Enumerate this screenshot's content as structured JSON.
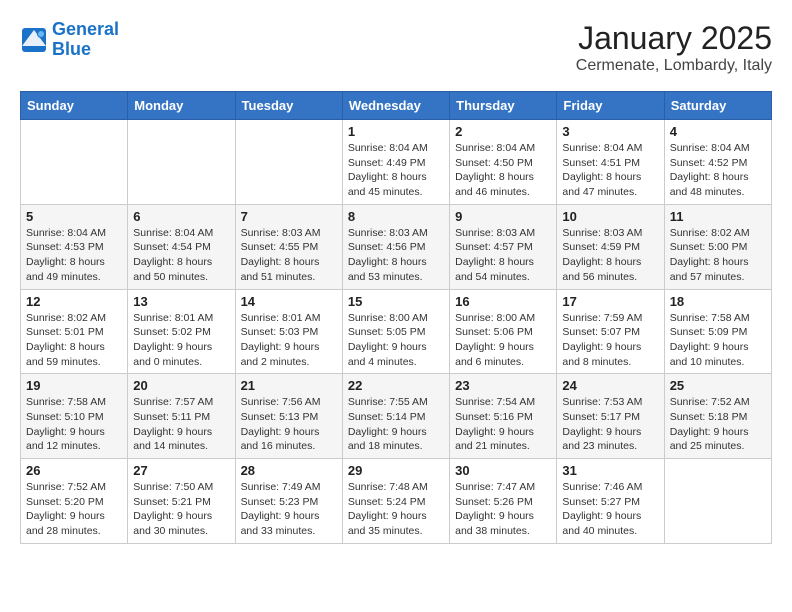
{
  "logo": {
    "line1": "General",
    "line2": "Blue"
  },
  "title": "January 2025",
  "location": "Cermenate, Lombardy, Italy",
  "weekdays": [
    "Sunday",
    "Monday",
    "Tuesday",
    "Wednesday",
    "Thursday",
    "Friday",
    "Saturday"
  ],
  "weeks": [
    [
      {
        "day": "",
        "info": ""
      },
      {
        "day": "",
        "info": ""
      },
      {
        "day": "",
        "info": ""
      },
      {
        "day": "1",
        "info": "Sunrise: 8:04 AM\nSunset: 4:49 PM\nDaylight: 8 hours\nand 45 minutes."
      },
      {
        "day": "2",
        "info": "Sunrise: 8:04 AM\nSunset: 4:50 PM\nDaylight: 8 hours\nand 46 minutes."
      },
      {
        "day": "3",
        "info": "Sunrise: 8:04 AM\nSunset: 4:51 PM\nDaylight: 8 hours\nand 47 minutes."
      },
      {
        "day": "4",
        "info": "Sunrise: 8:04 AM\nSunset: 4:52 PM\nDaylight: 8 hours\nand 48 minutes."
      }
    ],
    [
      {
        "day": "5",
        "info": "Sunrise: 8:04 AM\nSunset: 4:53 PM\nDaylight: 8 hours\nand 49 minutes."
      },
      {
        "day": "6",
        "info": "Sunrise: 8:04 AM\nSunset: 4:54 PM\nDaylight: 8 hours\nand 50 minutes."
      },
      {
        "day": "7",
        "info": "Sunrise: 8:03 AM\nSunset: 4:55 PM\nDaylight: 8 hours\nand 51 minutes."
      },
      {
        "day": "8",
        "info": "Sunrise: 8:03 AM\nSunset: 4:56 PM\nDaylight: 8 hours\nand 53 minutes."
      },
      {
        "day": "9",
        "info": "Sunrise: 8:03 AM\nSunset: 4:57 PM\nDaylight: 8 hours\nand 54 minutes."
      },
      {
        "day": "10",
        "info": "Sunrise: 8:03 AM\nSunset: 4:59 PM\nDaylight: 8 hours\nand 56 minutes."
      },
      {
        "day": "11",
        "info": "Sunrise: 8:02 AM\nSunset: 5:00 PM\nDaylight: 8 hours\nand 57 minutes."
      }
    ],
    [
      {
        "day": "12",
        "info": "Sunrise: 8:02 AM\nSunset: 5:01 PM\nDaylight: 8 hours\nand 59 minutes."
      },
      {
        "day": "13",
        "info": "Sunrise: 8:01 AM\nSunset: 5:02 PM\nDaylight: 9 hours\nand 0 minutes."
      },
      {
        "day": "14",
        "info": "Sunrise: 8:01 AM\nSunset: 5:03 PM\nDaylight: 9 hours\nand 2 minutes."
      },
      {
        "day": "15",
        "info": "Sunrise: 8:00 AM\nSunset: 5:05 PM\nDaylight: 9 hours\nand 4 minutes."
      },
      {
        "day": "16",
        "info": "Sunrise: 8:00 AM\nSunset: 5:06 PM\nDaylight: 9 hours\nand 6 minutes."
      },
      {
        "day": "17",
        "info": "Sunrise: 7:59 AM\nSunset: 5:07 PM\nDaylight: 9 hours\nand 8 minutes."
      },
      {
        "day": "18",
        "info": "Sunrise: 7:58 AM\nSunset: 5:09 PM\nDaylight: 9 hours\nand 10 minutes."
      }
    ],
    [
      {
        "day": "19",
        "info": "Sunrise: 7:58 AM\nSunset: 5:10 PM\nDaylight: 9 hours\nand 12 minutes."
      },
      {
        "day": "20",
        "info": "Sunrise: 7:57 AM\nSunset: 5:11 PM\nDaylight: 9 hours\nand 14 minutes."
      },
      {
        "day": "21",
        "info": "Sunrise: 7:56 AM\nSunset: 5:13 PM\nDaylight: 9 hours\nand 16 minutes."
      },
      {
        "day": "22",
        "info": "Sunrise: 7:55 AM\nSunset: 5:14 PM\nDaylight: 9 hours\nand 18 minutes."
      },
      {
        "day": "23",
        "info": "Sunrise: 7:54 AM\nSunset: 5:16 PM\nDaylight: 9 hours\nand 21 minutes."
      },
      {
        "day": "24",
        "info": "Sunrise: 7:53 AM\nSunset: 5:17 PM\nDaylight: 9 hours\nand 23 minutes."
      },
      {
        "day": "25",
        "info": "Sunrise: 7:52 AM\nSunset: 5:18 PM\nDaylight: 9 hours\nand 25 minutes."
      }
    ],
    [
      {
        "day": "26",
        "info": "Sunrise: 7:52 AM\nSunset: 5:20 PM\nDaylight: 9 hours\nand 28 minutes."
      },
      {
        "day": "27",
        "info": "Sunrise: 7:50 AM\nSunset: 5:21 PM\nDaylight: 9 hours\nand 30 minutes."
      },
      {
        "day": "28",
        "info": "Sunrise: 7:49 AM\nSunset: 5:23 PM\nDaylight: 9 hours\nand 33 minutes."
      },
      {
        "day": "29",
        "info": "Sunrise: 7:48 AM\nSunset: 5:24 PM\nDaylight: 9 hours\nand 35 minutes."
      },
      {
        "day": "30",
        "info": "Sunrise: 7:47 AM\nSunset: 5:26 PM\nDaylight: 9 hours\nand 38 minutes."
      },
      {
        "day": "31",
        "info": "Sunrise: 7:46 AM\nSunset: 5:27 PM\nDaylight: 9 hours\nand 40 minutes."
      },
      {
        "day": "",
        "info": ""
      }
    ]
  ]
}
